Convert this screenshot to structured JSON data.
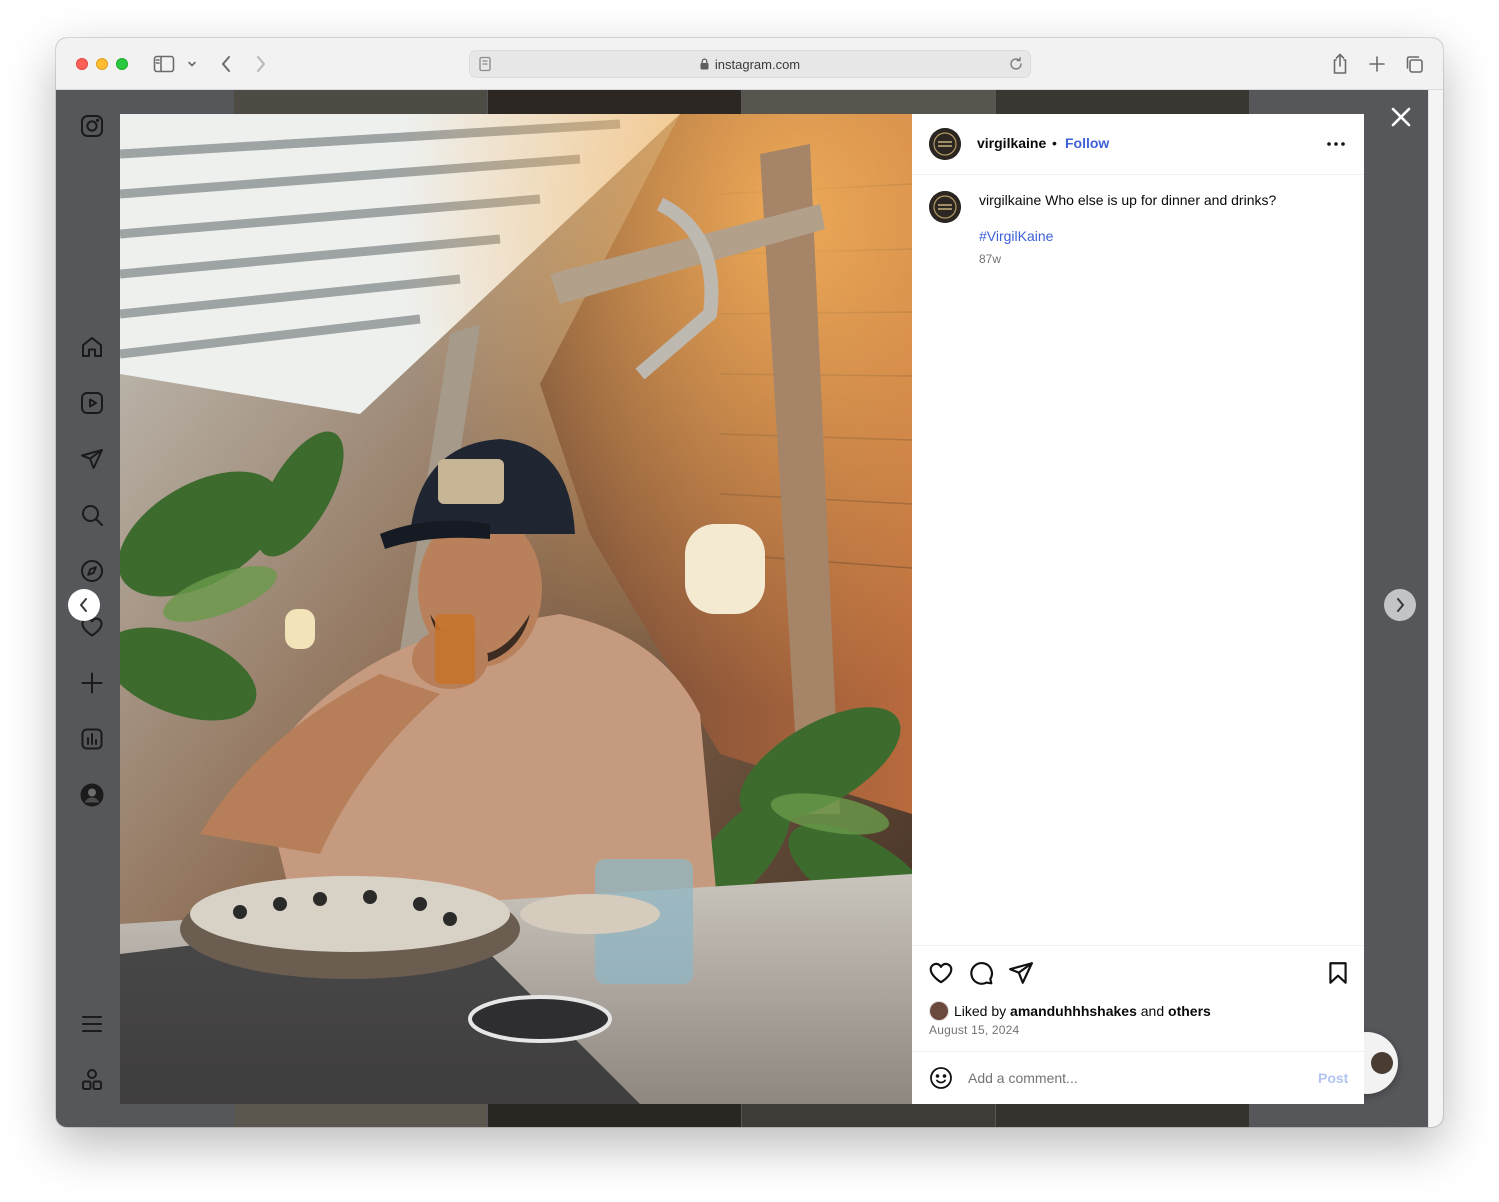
{
  "browser": {
    "url": "instagram.com",
    "icons": [
      "sidebar-icon",
      "chevron-down-icon",
      "back-icon",
      "forward-icon",
      "reader-icon",
      "lock-icon",
      "reload-icon",
      "share-icon",
      "new-tab-icon",
      "tabs-overview-icon"
    ]
  },
  "sidebar": {
    "items": [
      {
        "icon": "instagram-logo-icon"
      },
      {
        "icon": "home-icon"
      },
      {
        "icon": "reels-icon"
      },
      {
        "icon": "messages-icon"
      },
      {
        "icon": "search-icon"
      },
      {
        "icon": "explore-icon"
      },
      {
        "icon": "notifications-icon"
      },
      {
        "icon": "create-icon"
      },
      {
        "icon": "dashboard-icon"
      },
      {
        "icon": "profile-avatar"
      },
      {
        "icon": "menu-icon"
      },
      {
        "icon": "more-apps-icon"
      }
    ]
  },
  "post": {
    "username": "virgilkaine",
    "separator": "•",
    "follow_label": "Follow",
    "caption_user": "virgilkaine",
    "caption_text": "Who else is up for dinner and drinks?",
    "hashtag": "#VirgilKaine",
    "age": "87w",
    "liked_prefix": "Liked by",
    "liked_user": "amanduhhhshakes",
    "liked_and": "and",
    "liked_others": "others",
    "date": "August 15, 2024",
    "comment_placeholder": "Add a comment...",
    "post_label": "Post"
  },
  "colors": {
    "link_blue": "#3d5fd8",
    "post_disabled": "#b3c3f2",
    "overlay": "#55575b"
  }
}
